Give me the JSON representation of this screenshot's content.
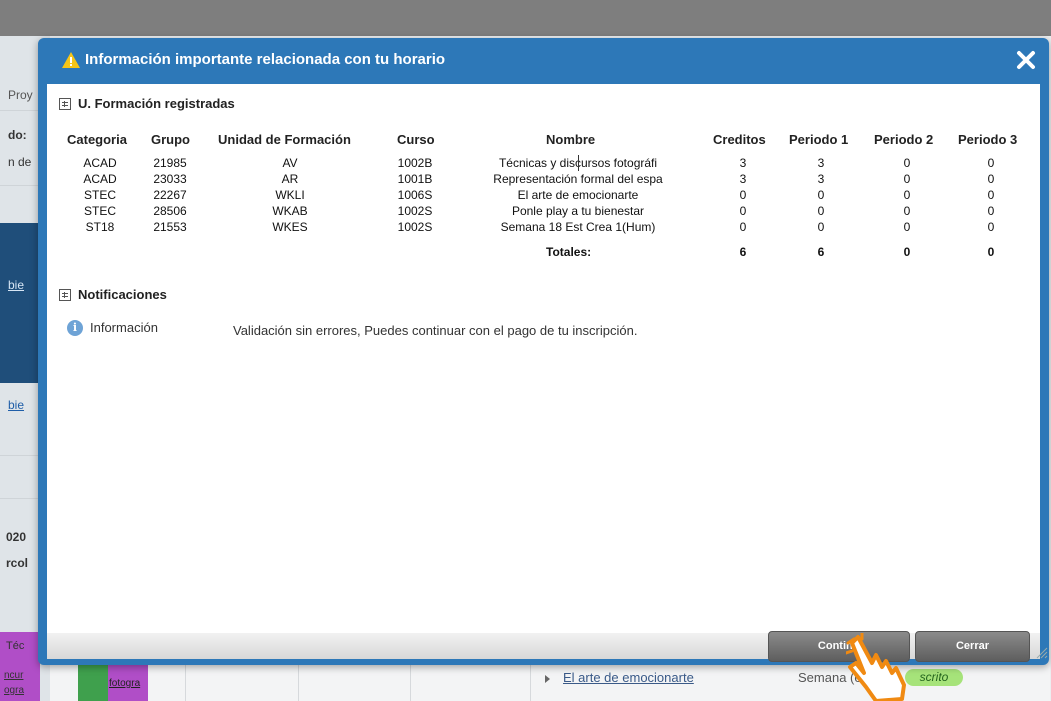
{
  "background": {
    "sidebar_fragments": [
      "Proy",
      "do: ",
      "n de",
      "bie",
      "bie",
      "020",
      "rcol",
      "Téc",
      "ncur",
      "ogra"
    ],
    "cell_fragment": "fotogra",
    "bottom_link": "El arte de emocionarte",
    "bottom_text": "Semana (e",
    "bottom_badge": "scrito"
  },
  "modal": {
    "title": "Información importante relacionada con tu horario",
    "close_icon": "close-icon",
    "section_registered": "U. Formación registradas",
    "table": {
      "headers": [
        "Categoria",
        "Grupo",
        "Unidad de Formación",
        "Curso",
        "Nombre",
        "Creditos",
        "Periodo 1",
        "Periodo 2",
        "Periodo 3"
      ],
      "rows": [
        [
          "ACAD",
          "21985",
          "AV",
          "1002B",
          "Técnicas y discursos fotográfi",
          "3",
          "3",
          "0",
          "0"
        ],
        [
          "ACAD",
          "23033",
          "AR",
          "1001B",
          "Representación formal del espa",
          "3",
          "3",
          "0",
          "0"
        ],
        [
          "STEC",
          "22267",
          "WKLI",
          "1006S",
          "El arte de emocionarte",
          "0",
          "0",
          "0",
          "0"
        ],
        [
          "STEC",
          "28506",
          "WKAB",
          "1002S",
          "Ponle play a tu bienestar",
          "0",
          "0",
          "0",
          "0"
        ],
        [
          "ST18",
          "21553",
          "WKES",
          "1002S",
          "Semana 18 Est Crea 1(Hum)",
          "0",
          "0",
          "0",
          "0"
        ]
      ],
      "totals_label": "Totales:",
      "totals": [
        "6",
        "6",
        "0",
        "0"
      ]
    },
    "section_notifications": "Notificaciones",
    "notification": {
      "type": "Información",
      "message": "Validación sin errores, Puedes continuar con el pago de tu inscripción."
    },
    "buttons": {
      "continue": "Contin  r",
      "close": "Cerrar"
    }
  },
  "colors": {
    "header": "#2d78b8",
    "button": "#6f6f6f",
    "info": "#6ea3d6"
  }
}
